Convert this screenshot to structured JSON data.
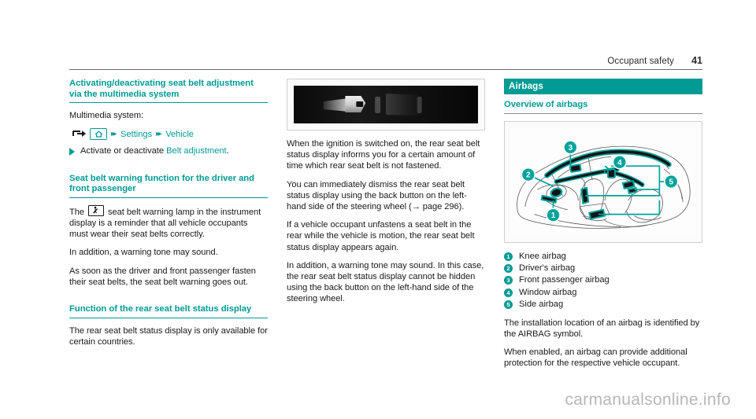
{
  "header": {
    "chapter_title": "Occupant safety",
    "page_number": "41"
  },
  "left_column": {
    "section1": {
      "heading": "Activating/deactivating seat belt adjustment via the multimedia system",
      "intro": "Multimedia system:",
      "path": {
        "turn_arrow_icon": "turn-arrow-icon",
        "home_icon": "home-icon",
        "chevron1": "▸▸",
        "item1": "Settings",
        "chevron2": "▸▸",
        "item2": "Vehicle"
      },
      "step_text_before": "Activate or deactivate ",
      "step_text_link": "Belt adjustment",
      "step_text_after": "."
    },
    "section2": {
      "heading": "Seat belt warning function for the driver and front passenger",
      "para1_before": "The ",
      "para1_icon": "seatbelt-warning-lamp-icon",
      "para1_after": " seat belt warning lamp in the instrument display is a reminder that all vehicle occupants must wear their seat belts correctly.",
      "para2": "In addition, a warning tone may sound.",
      "para3": "As soon as the driver and front passenger fasten their seat belts, the seat belt warning goes out."
    },
    "section3": {
      "heading": "Function of the rear seat belt status display",
      "para1": "The rear seat belt status display is only available for certain countries."
    }
  },
  "middle_column": {
    "figure": {
      "name": "rear-seat-belt-status-display-photo",
      "caption": ""
    },
    "para1": "When the ignition is switched on, the rear seat belt status display informs you for a certain amount of time which rear seat belt is not fastened.",
    "para2": "You can immediately dismiss the rear seat belt status display using the back button on the left-hand side of the steering wheel (→ page 296).",
    "para3": "If a vehicle occupant unfastens a seat belt in the rear while the vehicle is motion, the rear seat belt status display appears again.",
    "para4": "In addition, a warning tone may sound. In this case, the rear seat belt status display cannot be hidden using the back button on the left-hand side of the steering wheel."
  },
  "right_column": {
    "chapter_banner": "Airbags",
    "heading": "Overview of airbags",
    "figure": {
      "name": "airbag-location-diagram",
      "callouts": [
        "1",
        "2",
        "3",
        "4",
        "5"
      ]
    },
    "legend": [
      {
        "num": "1",
        "label": "Knee airbag"
      },
      {
        "num": "2",
        "label": "Driver's airbag"
      },
      {
        "num": "3",
        "label": "Front passenger airbag"
      },
      {
        "num": "4",
        "label": "Window airbag"
      },
      {
        "num": "5",
        "label": "Side airbag"
      }
    ],
    "para1": "The installation location of an airbag is identified by the AIRBAG symbol.",
    "para2": "When enabled, an airbag can provide additional protection for the respective vehicle occupant."
  },
  "watermark": "carmanualsonline.info",
  "colors": {
    "accent_teal": "#009b95",
    "text": "#1a1a1a",
    "watermark_grey": "#b7b7b7"
  }
}
